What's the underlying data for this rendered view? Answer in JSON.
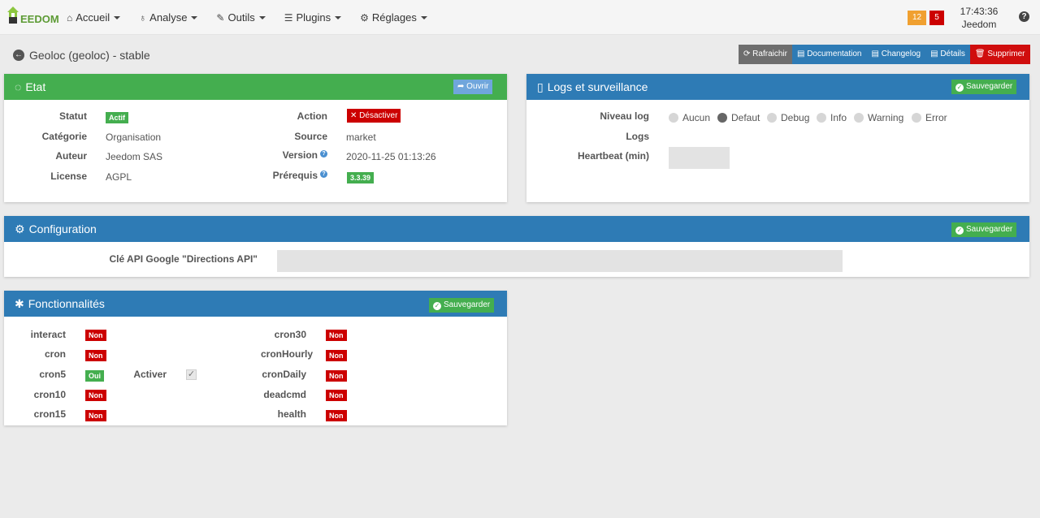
{
  "navbar": {
    "brand": "EEDOM",
    "menu": [
      {
        "label": "Accueil",
        "icon": "home-icon"
      },
      {
        "label": "Analyse",
        "icon": "stethoscope-icon"
      },
      {
        "label": "Outils",
        "icon": "wrench-icon"
      },
      {
        "label": "Plugins",
        "icon": "list-icon"
      },
      {
        "label": "Réglages",
        "icon": "gear-icon"
      }
    ],
    "badge_orange": "12",
    "badge_red": "5",
    "time": "17:43:36",
    "user": "Jeedom",
    "help": "?"
  },
  "page": {
    "title": "Geoloc (geoloc) - stable"
  },
  "actions": {
    "refresh": "Rafraichir",
    "documentation": "Documentation",
    "changelog": "Changelog",
    "details": "Détails",
    "delete": "Supprimer"
  },
  "etat": {
    "title": "Etat",
    "open_button": "Ouvrir",
    "statut_label": "Statut",
    "statut_value": "Actif",
    "categorie_label": "Catégorie",
    "categorie_value": "Organisation",
    "auteur_label": "Auteur",
    "auteur_value": "Jeedom SAS",
    "license_label": "License",
    "license_value": "AGPL",
    "action_label": "Action",
    "action_button": "Désactiver",
    "source_label": "Source",
    "source_value": "market",
    "version_label": "Version",
    "version_value": "2020-11-25 01:13:26",
    "prerequis_label": "Prérequis",
    "prerequis_value": "3.3.39"
  },
  "logs": {
    "title": "Logs et surveillance",
    "save_button": "Sauvegarder",
    "niveau_label": "Niveau log",
    "levels": [
      "Aucun",
      "Defaut",
      "Debug",
      "Info",
      "Warning",
      "Error"
    ],
    "selected_level": "Defaut",
    "logs_label": "Logs",
    "heartbeat_label": "Heartbeat (min)",
    "heartbeat_value": ""
  },
  "config": {
    "title": "Configuration",
    "save_button": "Sauvegarder",
    "api_label": "Clé API Google \"Directions API\"",
    "api_value": ""
  },
  "fonctionnalites": {
    "title": "Fonctionnalités",
    "save_button": "Sauvegarder",
    "left": [
      {
        "name": "interact",
        "state": "Non"
      },
      {
        "name": "cron",
        "state": "Non"
      },
      {
        "name": "cron5",
        "state": "Oui"
      },
      {
        "name": "cron10",
        "state": "Non"
      },
      {
        "name": "cron15",
        "state": "Non"
      }
    ],
    "activer_label": "Activer",
    "activer_checked": true,
    "right": [
      {
        "name": "cron30",
        "state": "Non"
      },
      {
        "name": "cronHourly",
        "state": "Non"
      },
      {
        "name": "cronDaily",
        "state": "Non"
      },
      {
        "name": "deadcmd",
        "state": "Non"
      },
      {
        "name": "health",
        "state": "Non"
      }
    ]
  }
}
